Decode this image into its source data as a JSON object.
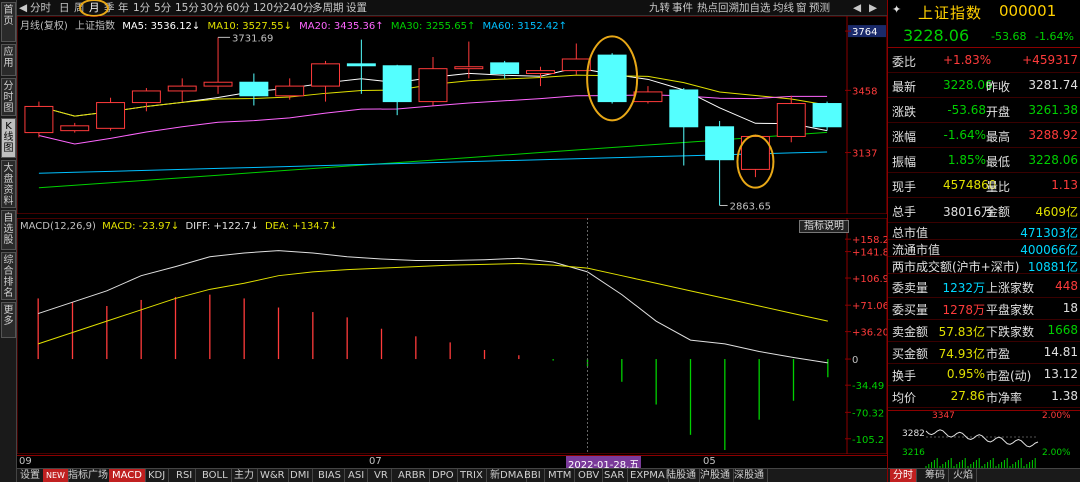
{
  "left_tabs": [
    "首页",
    "应用",
    "分时图",
    "K线图",
    "大盘资料",
    "自选股",
    "综合排名",
    "更多"
  ],
  "toolbar": {
    "items": [
      "分时",
      "日",
      "周",
      "月",
      "季",
      "年",
      "1分",
      "5分",
      "15分",
      "30分",
      "60分",
      "120分",
      "240分",
      "多周期",
      "设置"
    ],
    "selected": "月",
    "right_items": [
      "九转",
      "事件",
      "热点回溯",
      "加自选",
      "均线",
      "窗",
      "预测"
    ]
  },
  "main_legend": {
    "title": "月线(复权)",
    "name": "上证指数",
    "ma5": "MA5: 3536.12↓",
    "ma10": "MA10: 3527.55↓",
    "ma20": "MA20: 3435.36↑",
    "ma30": "MA30: 3255.65↑",
    "ma60": "MA60: 3152.42↑",
    "high_label": "3731.69",
    "low_label": "2863.65",
    "price_ticks": [
      "3764",
      "3458",
      "3137"
    ]
  },
  "macd_legend": {
    "title": "MACD(12,26,9)",
    "macd": "MACD: -23.97↓",
    "diff": "DIFF: +122.7↓",
    "dea": "DEA: +134.7↓",
    "button": "指标说明",
    "ticks": [
      "+158.2",
      "+141.8",
      "+106.9",
      "+71.06",
      "+36.20",
      "0",
      "-34.49",
      "-70.32",
      "-105.2"
    ]
  },
  "time_axis": {
    "labels": [
      "09",
      "07",
      "2022-01-28,五",
      "05"
    ]
  },
  "bottom_tabs": {
    "items": [
      "设置",
      "NEW",
      "指标广场",
      "MACD",
      "KDJ",
      "RSI",
      "BOLL",
      "主力",
      "W&R",
      "DMI",
      "BIAS",
      "ASI",
      "VR",
      "ARBR",
      "DPO",
      "TRIX",
      "新DMA",
      "BBI",
      "MTM",
      "OBV",
      "SAR",
      "EXPMA",
      "陆股通",
      "沪股通",
      "深股通"
    ],
    "active": "MACD"
  },
  "quote": {
    "name": "上证指数",
    "code": "000001",
    "price": "3228.06",
    "change": "-53.68",
    "change_pct": "-1.64%",
    "rows": [
      {
        "l1": "委比",
        "v1": "+1.83%",
        "c1": "red",
        "l2": "",
        "v2": "+459317",
        "c2": "red"
      },
      {
        "l1": "最新",
        "v1": "3228.06",
        "c1": "green",
        "l2": "昨收",
        "v2": "3281.74",
        "c2": "white"
      },
      {
        "l1": "涨跌",
        "v1": "-53.68",
        "c1": "green",
        "l2": "开盘",
        "v2": "3261.38",
        "c2": "green"
      },
      {
        "l1": "涨幅",
        "v1": "-1.64%",
        "c1": "green",
        "l2": "最高",
        "v2": "3288.92",
        "c2": "red"
      },
      {
        "l1": "振幅",
        "v1": "1.85%",
        "c1": "green",
        "l2": "最低",
        "v2": "3228.06",
        "c2": "green"
      },
      {
        "l1": "现手",
        "v1": "4574860",
        "c1": "yellow",
        "l2": "量比",
        "v2": "1.13",
        "c2": "red"
      },
      {
        "l1": "总手",
        "v1": "38016万",
        "c1": "white",
        "l2": "金额",
        "v2": "4609亿",
        "c2": "yellow"
      }
    ],
    "mkt_rows": [
      {
        "l": "总市值",
        "v": "471303亿"
      },
      {
        "l": "流通市值",
        "v": "400066亿"
      },
      {
        "l": "两市成交额(沪市+深市)",
        "v": "10881亿"
      }
    ],
    "rows2": [
      {
        "l1": "委卖量",
        "v1": "1232万",
        "c1": "cyan",
        "l2": "上涨家数",
        "v2": "448",
        "c2": "red"
      },
      {
        "l1": "委买量",
        "v1": "1278万",
        "c1": "red",
        "l2": "平盘家数",
        "v2": "18",
        "c2": "white"
      },
      {
        "l1": "卖金额",
        "v1": "57.83亿",
        "c1": "yellow",
        "l2": "下跌家数",
        "v2": "1668",
        "c2": "green"
      },
      {
        "l1": "买金额",
        "v1": "74.93亿",
        "c1": "yellow",
        "l2": "市盈",
        "v2": "14.81",
        "c2": "white"
      },
      {
        "l1": "换手",
        "v1": "0.95%",
        "c1": "yellow",
        "l2": "市盈(动)",
        "v2": "13.12",
        "c2": "white"
      },
      {
        "l1": "均价",
        "v1": "27.86",
        "c1": "yellow",
        "l2": "市净率",
        "v2": "1.38",
        "c2": "white"
      }
    ],
    "mini": {
      "top": "3347",
      "mid": "3282",
      "low": "3216",
      "pct_top": "2.00%",
      "pct_low": "2.00%"
    },
    "mini_tabs": [
      "分时",
      "筹码",
      "火焰"
    ]
  },
  "chart_data": [
    {
      "type": "candlestick",
      "title": "月线(复权)",
      "ylim": [
        2830,
        3780
      ],
      "candles": [
        {
          "o": 3240,
          "c": 3375,
          "h": 3400,
          "l": 3215
        },
        {
          "o": 3250,
          "c": 3275,
          "h": 3290,
          "l": 3240
        },
        {
          "o": 3262,
          "c": 3395,
          "h": 3420,
          "l": 3250
        },
        {
          "o": 3395,
          "c": 3455,
          "h": 3470,
          "l": 3350
        },
        {
          "o": 3455,
          "c": 3480,
          "h": 3520,
          "l": 3400
        },
        {
          "o": 3480,
          "c": 3500,
          "h": 3731.69,
          "l": 3440
        },
        {
          "o": 3500,
          "c": 3430,
          "h": 3545,
          "l": 3380
        },
        {
          "o": 3430,
          "c": 3480,
          "h": 3520,
          "l": 3410
        },
        {
          "o": 3480,
          "c": 3595,
          "h": 3610,
          "l": 3400
        },
        {
          "o": 3595,
          "c": 3585,
          "h": 3720,
          "l": 3440
        },
        {
          "o": 3585,
          "c": 3400,
          "h": 3590,
          "l": 3330
        },
        {
          "o": 3400,
          "c": 3570,
          "h": 3630,
          "l": 3380
        },
        {
          "o": 3570,
          "c": 3580,
          "h": 3710,
          "l": 3520
        },
        {
          "o": 3600,
          "c": 3545,
          "h": 3610,
          "l": 3520
        },
        {
          "o": 3545,
          "c": 3560,
          "h": 3580,
          "l": 3480
        },
        {
          "o": 3560,
          "c": 3620,
          "h": 3700,
          "l": 3540
        },
        {
          "o": 3640,
          "c": 3400,
          "h": 3650,
          "l": 3390
        },
        {
          "o": 3400,
          "c": 3450,
          "h": 3480,
          "l": 3390
        },
        {
          "o": 3460,
          "c": 3270,
          "h": 3470,
          "l": 3070
        },
        {
          "o": 3270,
          "c": 3100,
          "h": 3300,
          "l": 2863.65
        },
        {
          "o": 3050,
          "c": 3220,
          "h": 3230,
          "l": 3010
        },
        {
          "o": 3220,
          "c": 3390,
          "h": 3430,
          "l": 3190
        },
        {
          "o": 3390,
          "c": 3270,
          "h": 3400,
          "l": 3250
        }
      ]
    },
    {
      "type": "bar",
      "title": "MACD(12,26,9)",
      "ylim": [
        -120,
        165
      ],
      "macd": [
        80,
        75,
        70,
        78,
        82,
        85,
        80,
        68,
        62,
        55,
        40,
        30,
        22,
        12,
        5,
        -2,
        -10,
        -30,
        -60,
        -100,
        -120,
        -80,
        -55,
        -24
      ],
      "diff": [
        60,
        75,
        90,
        110,
        122,
        135,
        140,
        143,
        140,
        135,
        132,
        130,
        130,
        131,
        133,
        128,
        115,
        85,
        50,
        25,
        20,
        10,
        2,
        -5
      ],
      "dea": [
        20,
        35,
        50,
        65,
        80,
        92,
        100,
        110,
        115,
        118,
        120,
        122,
        124,
        125,
        126,
        124,
        120,
        110,
        100,
        90,
        80,
        70,
        60,
        50
      ]
    }
  ]
}
